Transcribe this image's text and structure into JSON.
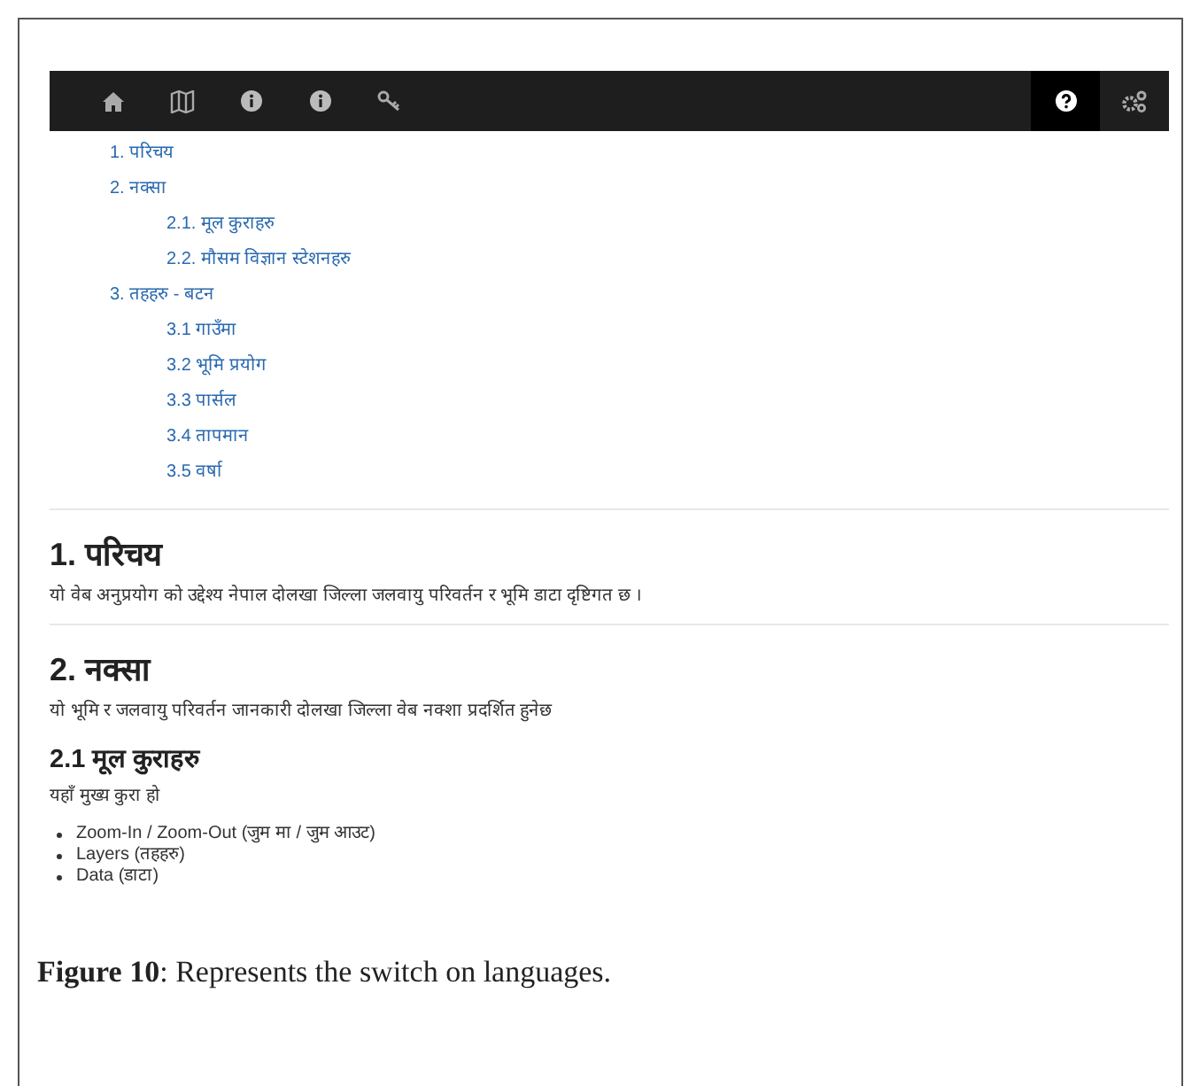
{
  "navbar": {
    "left": [
      {
        "kind": "home",
        "selected": false
      },
      {
        "kind": "map",
        "selected": false
      },
      {
        "kind": "info",
        "selected": false
      },
      {
        "kind": "info",
        "selected": false
      },
      {
        "kind": "key",
        "selected": false
      }
    ],
    "right": [
      {
        "kind": "help",
        "selected": true
      },
      {
        "kind": "gears",
        "selected": false
      }
    ]
  },
  "toc": [
    {
      "label": "1. परिचय"
    },
    {
      "label": "2. नक्सा",
      "children": [
        {
          "label": "2.1. मूल कुराहरु"
        },
        {
          "label": "2.2. मौसम विज्ञान स्टेशनहरु"
        }
      ]
    },
    {
      "label": "3. तहहरु - बटन",
      "children": [
        {
          "label": "3.1 गाउँमा"
        },
        {
          "label": "3.2 भूमि प्रयोग"
        },
        {
          "label": "3.3 पार्सल"
        },
        {
          "label": "3.4 तापमान"
        },
        {
          "label": "3.5 वर्षा"
        }
      ]
    }
  ],
  "sections": [
    {
      "heading": "1. परिचय",
      "text": "यो वेब अनुप्रयोग को उद्देश्य नेपाल दोलखा जिल्ला जलवायु परिवर्तन र भूमि डाटा दृष्टिगत छ ।"
    },
    {
      "heading": "2. नक्सा",
      "text": "यो भूमि र जलवायु परिवर्तन जानकारी दोलखा जिल्ला वेब नक्शा प्रदर्शित हुनेछ",
      "subsections": [
        {
          "heading": "2.1 मूल कुराहरु",
          "text": "यहाँ मुख्य कुरा हो",
          "bullets": [
            "Zoom-In / Zoom-Out (जुम मा / जुम आउट)",
            "Layers (तहहरु)",
            "Data (डाटा)"
          ]
        }
      ]
    }
  ],
  "caption": "**Figure 10**: Represents the switch on languages."
}
